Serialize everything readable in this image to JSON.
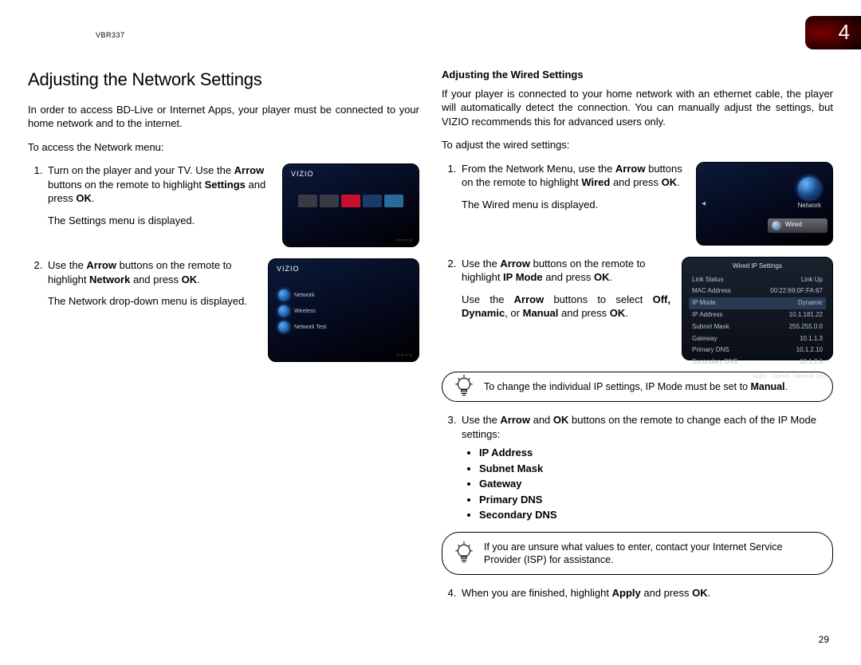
{
  "model": "VBR337",
  "chapter_number": "4",
  "page_number": "29",
  "left": {
    "heading": "Adjusting the Network Settings",
    "intro": "In order to access BD-Live or Internet Apps, your player must be connected to your home network and to the internet.",
    "access_label": "To access the Network menu:",
    "step1_a": "Turn on the player and your TV. Use the ",
    "step1_b": "Arrow",
    "step1_c": " buttons on the remote to highlight ",
    "step1_d": "Settings",
    "step1_e": " and press ",
    "step1_f": "OK",
    "step1_g": ".",
    "step1_result": "The Settings menu is displayed.",
    "step2_a": "Use the ",
    "step2_b": "Arrow",
    "step2_c": " buttons on the remote to highlight ",
    "step2_d": "Network",
    "step2_e": " and press ",
    "step2_f": "OK",
    "step2_g": ".",
    "step2_result": "The Network drop-down menu is displayed."
  },
  "right": {
    "heading": "Adjusting the Wired Settings",
    "intro": "If your player is connected to your home network with an ethernet cable, the player will automatically detect the connection. You can manually adjust the settings, but VIZIO recommends this for advanced users only.",
    "access_label": "To adjust the wired settings:",
    "step1_a": "From the Network Menu, use the ",
    "step1_b": "Arrow",
    "step1_c": " buttons on the remote to highlight ",
    "step1_d": "Wired",
    "step1_e": " and press ",
    "step1_f": "OK",
    "step1_g": ".",
    "step1_result": "The Wired menu is displayed.",
    "step2_a": "Use the ",
    "step2_b": "Arrow",
    "step2_c": " buttons on the remote to highlight ",
    "step2_d": "IP Mode",
    "step2_e": " and press ",
    "step2_f": "OK",
    "step2_g": ".",
    "step2_h": "Use the ",
    "step2_i": "Arrow",
    "step2_j": " buttons to select ",
    "step2_k": "Off, Dynamic",
    "step2_l": ", or ",
    "step2_m": "Manual",
    "step2_n": " and press ",
    "step2_o": "OK",
    "step2_p": ".",
    "tip1_a": "To change the individual IP settings, IP Mode must be set to ",
    "tip1_b": "Manual",
    "tip1_c": ".",
    "step3_a": "Use the ",
    "step3_b": "Arrow",
    "step3_c": " and ",
    "step3_d": "OK",
    "step3_e": " buttons on the remote to change each of the IP Mode settings:",
    "bullets": [
      "IP Address",
      "Subnet Mask",
      "Gateway",
      "Primary DNS",
      "Secondary DNS"
    ],
    "tip2": "If you are unsure what values to enter, contact your Internet Service Provider (ISP) for assistance.",
    "step4_a": "When you are finished, highlight ",
    "step4_b": "Apply",
    "step4_c": " and press ",
    "step4_d": "OK",
    "step4_e": "."
  },
  "screenshots": {
    "vizio_brand": "VIZIO",
    "network_label": "Network",
    "wired_label": "Wired",
    "ip_title": "Wired IP Settings",
    "ip_rows": [
      {
        "k": "Link Status",
        "v": "Link Up"
      },
      {
        "k": "MAC Address",
        "v": "00:22:69:0F:FA:67"
      },
      {
        "k": "IP Mode",
        "v": "Dynamic"
      },
      {
        "k": "IP Address",
        "v": "10.1.181.22"
      },
      {
        "k": "Subnet Mask",
        "v": "255.255.0.0"
      },
      {
        "k": "Gateway",
        "v": "10.1.1.3"
      },
      {
        "k": "Primary DNS",
        "v": "10.1.2.10"
      },
      {
        "k": "Secondary DNS",
        "v": "10.1.2.6"
      }
    ],
    "ip_buttons": [
      "Apply",
      "Cancel",
      "Network Test"
    ]
  }
}
